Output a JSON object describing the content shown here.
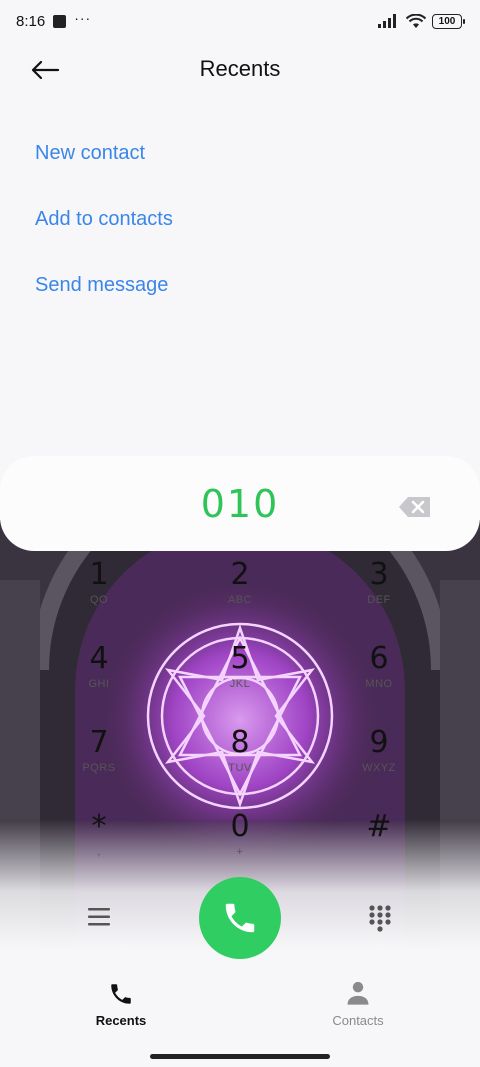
{
  "status_bar": {
    "time": "8:16",
    "more": "···",
    "battery": "100"
  },
  "header": {
    "title": "Recents"
  },
  "actions": [
    {
      "label": "New contact"
    },
    {
      "label": "Add to contacts"
    },
    {
      "label": "Send message"
    }
  ],
  "dialer": {
    "number": "010"
  },
  "keypad": [
    {
      "digit": "1",
      "letters": "QO"
    },
    {
      "digit": "2",
      "letters": "ABC"
    },
    {
      "digit": "3",
      "letters": "DEF"
    },
    {
      "digit": "4",
      "letters": "GHI"
    },
    {
      "digit": "5",
      "letters": "JKL"
    },
    {
      "digit": "6",
      "letters": "MNO"
    },
    {
      "digit": "7",
      "letters": "PQRS"
    },
    {
      "digit": "8",
      "letters": "TUV"
    },
    {
      "digit": "9",
      "letters": "WXYZ"
    },
    {
      "digit": "*",
      "letters": ","
    },
    {
      "digit": "0",
      "letters": "+"
    },
    {
      "digit": "#",
      "letters": ""
    }
  ],
  "bottom_nav": {
    "recents": "Recents",
    "contacts": "Contacts"
  },
  "colors": {
    "accent_blue": "#3a86e8",
    "call_green": "#2fcd62",
    "number_green": "#2ec458",
    "wallpaper_purple": "#b54be0"
  },
  "icons": {
    "back": "arrow-left-icon",
    "backspace": "backspace-icon",
    "menu": "menu-icon",
    "call": "phone-icon",
    "dialpad": "dialpad-icon",
    "recents": "phone-icon",
    "contacts": "person-icon"
  }
}
